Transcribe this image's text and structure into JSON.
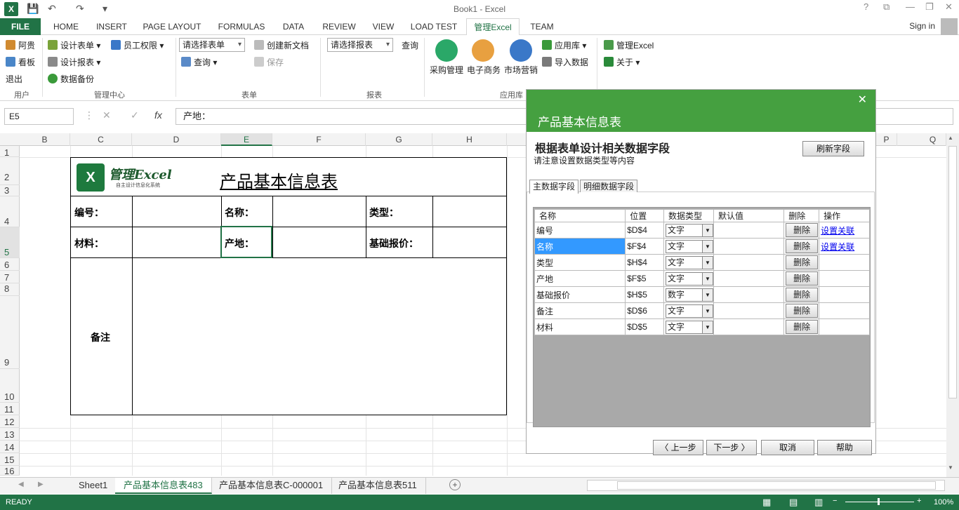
{
  "app": {
    "title": "Book1 - Excel",
    "logo": "X",
    "controls": [
      "?",
      "⧉",
      "—",
      "❐",
      "✕"
    ]
  },
  "menu": {
    "tabs": [
      "FILE",
      "HOME",
      "INSERT",
      "PAGE LAYOUT",
      "FORMULAS",
      "DATA",
      "REVIEW",
      "VIEW",
      "LOAD TEST",
      "管理Excel",
      "TEAM"
    ],
    "active": "管理Excel",
    "signin": "Sign in"
  },
  "ribbon": {
    "user": {
      "items": [
        "阿贵",
        "看板",
        "退出"
      ],
      "label": "用户"
    },
    "mgmt": {
      "items": [
        "设计表单",
        "员工权限",
        "设计报表",
        "数据备份"
      ],
      "label": "管理中心"
    },
    "form": {
      "select": "请选择表单",
      "query": "查询",
      "create": "创建新文档",
      "save": "保存",
      "label": "表单"
    },
    "report": {
      "select": "请选择报表",
      "query": "查询",
      "label": "报表"
    },
    "apps": {
      "items": [
        "采购管理",
        "电子商务",
        "市场营销"
      ],
      "lib": "应用库",
      "import": "导入数据",
      "label": "应用库"
    },
    "about": {
      "mgr": "管理Excel",
      "about": "关于"
    }
  },
  "formula": {
    "namebox": "E5",
    "value": "产地："
  },
  "columns": [
    "B",
    "C",
    "D",
    "E",
    "F",
    "G",
    "H",
    "P",
    "Q"
  ],
  "rows": [
    "1",
    "2",
    "3",
    "4",
    "5",
    "6",
    "7",
    "8",
    "9",
    "10",
    "11",
    "12",
    "13",
    "14",
    "15",
    "16"
  ],
  "form": {
    "title": "产品基本信息表",
    "logo_text": "管理Excel",
    "logo_sub": "自主设计信息化系统",
    "labels": {
      "code": "编号：",
      "name": "名称：",
      "type": "类型：",
      "material": "材料：",
      "origin": "产地：",
      "price": "基础报价：",
      "remark": "备注"
    }
  },
  "sheets": [
    "Sheet1",
    "产品基本信息表483",
    "产品基本信息表C-000001",
    "产品基本信息表511"
  ],
  "active_sheet": "产品基本信息表483",
  "status": {
    "ready": "READY",
    "zoom": "100%"
  },
  "panel": {
    "title": "产品基本信息表",
    "heading": "根据表单设计相关数据字段",
    "subheading": "请注意设置数据类型等内容",
    "refresh": "刷新字段",
    "tabs": [
      "主数据字段",
      "明细数据字段"
    ],
    "headers": [
      "名称",
      "位置",
      "数据类型",
      "默认值",
      "删除",
      "操作"
    ],
    "rows": [
      {
        "name": "编号",
        "pos": "$D$4",
        "type": "文字",
        "op": "设置关联"
      },
      {
        "name": "名称",
        "pos": "$F$4",
        "type": "文字",
        "op": "设置关联"
      },
      {
        "name": "类型",
        "pos": "$H$4",
        "type": "文字",
        "op": ""
      },
      {
        "name": "产地",
        "pos": "$F$5",
        "type": "文字",
        "op": ""
      },
      {
        "name": "基础报价",
        "pos": "$H$5",
        "type": "数字",
        "op": ""
      },
      {
        "name": "备注",
        "pos": "$D$6",
        "type": "文字",
        "op": ""
      },
      {
        "name": "材料",
        "pos": "$D$5",
        "type": "文字",
        "op": ""
      }
    ],
    "delete_label": "删除",
    "buttons": {
      "prev": "〈 上一步",
      "next": "下一步 〉",
      "cancel": "取消",
      "help": "帮助"
    }
  }
}
